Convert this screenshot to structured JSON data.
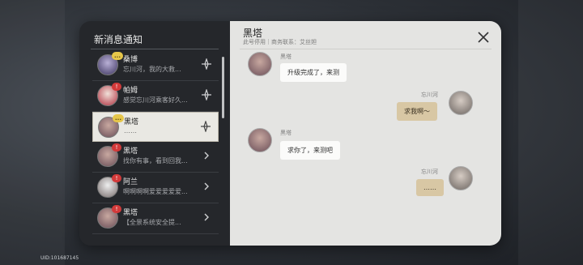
{
  "panel": {
    "title": "新消息通知"
  },
  "notifications": [
    {
      "name": "桑博",
      "preview": "忘川河，我的大救...",
      "badge": "...",
      "badge_type": "dots",
      "action_icon": "diamond-rune-icon"
    },
    {
      "name": "帕姆",
      "preview": "感觉忘川河乘客好久...",
      "badge": "!",
      "badge_type": "bang",
      "action_icon": "diamond-rune-icon"
    },
    {
      "name": "黑塔",
      "preview": "……",
      "badge": "...",
      "badge_type": "dots",
      "action_icon": "diamond-rune-icon",
      "selected": true
    },
    {
      "name": "黑塔",
      "preview": "找你有事，看到回我...",
      "badge": "!",
      "badge_type": "bang",
      "action_icon": "chevron-right-icon"
    },
    {
      "name": "阿兰",
      "preview": "啊啊啊啊爱爱爱爱爱...",
      "badge": "!",
      "badge_type": "bang",
      "action_icon": "chevron-right-icon"
    },
    {
      "name": "黑塔",
      "preview": "【全景系统安全提...",
      "badge": "!",
      "badge_type": "bang",
      "action_icon": "chevron-right-icon"
    }
  ],
  "chat": {
    "title": "黑塔",
    "subtitle": "此号停用｜商务联系：艾丝妲",
    "messages": [
      {
        "sender": "黑塔",
        "text": "升级完成了，来测",
        "side": "in"
      },
      {
        "sender": "忘川河",
        "text": "求我啊～",
        "side": "out"
      },
      {
        "sender": "黑塔",
        "text": "求你了，来测吧",
        "side": "in"
      },
      {
        "sender": "忘川河",
        "text": "……",
        "side": "out"
      }
    ]
  },
  "footer": {
    "uid": "UID:101687145"
  },
  "colors": {
    "panel_dark": "#25272b",
    "chat_bg": "#e4e4e2",
    "bubble_out": "#d8c7a4",
    "badge_yellow": "#e6c64a",
    "badge_red": "#d23a3a"
  }
}
